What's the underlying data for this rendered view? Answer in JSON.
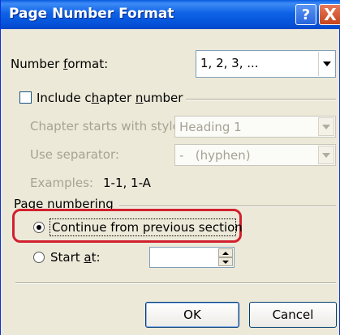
{
  "title": "Page Number Format",
  "titlebar": {
    "help_glyph": "?",
    "close_glyph": "X"
  },
  "number_format": {
    "label_pre": "Number ",
    "label_u": "f",
    "label_post": "ormat:",
    "value": "1, 2, 3, ..."
  },
  "include_chapter": {
    "label_pre": "Include c",
    "label_u": "h",
    "label_mid": "apter ",
    "label_u2": "n",
    "label_post": "umber",
    "checked": false
  },
  "chapter_style": {
    "label": "Chapter starts with style",
    "value": "Heading 1"
  },
  "separator": {
    "label": "Use separator:",
    "value": "-   (hyphen)"
  },
  "examples": {
    "label": "Examples:",
    "value": "1-1, 1-A"
  },
  "page_numbering": {
    "group_label": "Page numbering",
    "continue_label": "Continue from previous section",
    "continue_selected": true,
    "start_label_pre": "Start ",
    "start_label_u": "a",
    "start_label_post": "t:",
    "start_value": ""
  },
  "buttons": {
    "ok": "OK",
    "cancel": "Cancel"
  },
  "colors": {
    "title_bar": "#0553da",
    "dialog_bg": "#ece9d8",
    "highlight": "#d2202e"
  }
}
